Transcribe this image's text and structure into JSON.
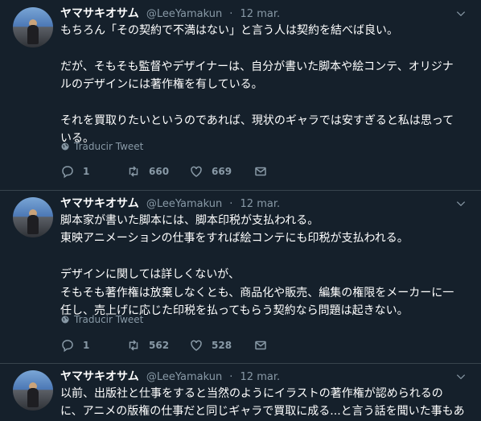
{
  "tweets": [
    {
      "name": "ヤマサキオサム",
      "handle": "@LeeYamakun",
      "separator": "·",
      "date": "12 mar.",
      "lines": [
        "もちろん「その契約で不満はない」と言う人は契約を結べば良い。",
        "",
        "だが、そもそも監督やデザイナーは、自分が書いた脚本や絵コンテ、オリジナ",
        "ルのデザインには著作権を有している。",
        "",
        "それを買取りたいというのであれば、現状のギャラでは安すぎると私は思って",
        "いる。"
      ],
      "translate": "Traducir Tweet",
      "replies": "1",
      "retweets": "660",
      "likes": "669"
    },
    {
      "name": "ヤマサキオサム",
      "handle": "@LeeYamakun",
      "separator": "·",
      "date": "12 mar.",
      "lines": [
        "脚本家が書いた脚本には、脚本印税が支払われる。",
        "東映アニメーションの仕事をすれば絵コンテにも印税が支払われる。",
        "",
        "デザインに関しては詳しくないが、",
        "そもそも著作権は放棄しなくとも、商品化や販売、編集の権限をメーカーに一",
        "任し、売上げに応じた印税を払ってもらう契約なら問題は起きない。"
      ],
      "translate": "Traducir Tweet",
      "replies": "1",
      "retweets": "562",
      "likes": "528"
    },
    {
      "name": "ヤマサキオサム",
      "handle": "@LeeYamakun",
      "separator": "·",
      "date": "12 mar.",
      "lines": [
        "以前、出版社と仕事をすると当然のようにイラストの著作権が認められるの",
        "に、アニメの版権の仕事だと同じギャラで買取に成る...と言う話を聞いた事もあ"
      ]
    }
  ]
}
